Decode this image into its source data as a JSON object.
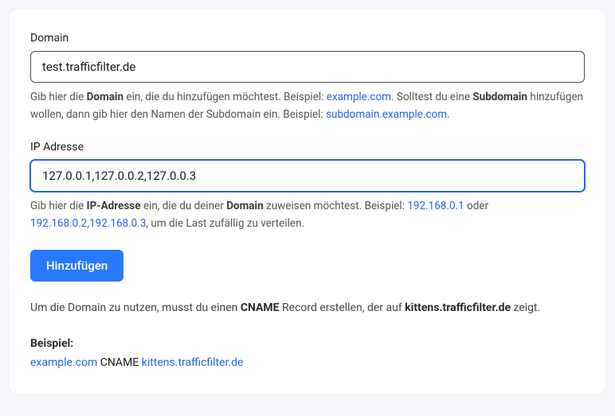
{
  "domain": {
    "label": "Domain",
    "value": "test.trafficfilter.de",
    "help_prefix": "Gib hier die ",
    "help_strong1": "Domain",
    "help_mid1": " ein, die du hinzufügen möchtest. Beispiel: ",
    "help_example1": "example.com",
    "help_mid2": ". Solltest du eine ",
    "help_strong2": "Subdomain",
    "help_mid3": " hinzufügen wollen, dann gib hier den Namen der Subdomain ein. Beispiel: ",
    "help_example2": "subdomain.example.com",
    "help_suffix": "."
  },
  "ip": {
    "label": "IP Adresse",
    "value": "127.0.0.1,127.0.0.2,127.0.0.3",
    "help_prefix": "Gib hier die ",
    "help_strong1": "IP-Adresse",
    "help_mid1": " ein, die du deiner ",
    "help_strong2": "Domain",
    "help_mid2": " zuweisen möchtest. Beispiel: ",
    "help_example1": "192.168.0.1",
    "help_mid3": " oder ",
    "help_example2": "192.168.0.2,192.168.0.3",
    "help_suffix": ", um die Last zufällig zu verteilen."
  },
  "submit": {
    "label": "Hinzufügen"
  },
  "cname": {
    "text_prefix": "Um die Domain zu nutzen, musst du einen ",
    "text_strong": "CNAME",
    "text_mid": " Record erstellen, der auf ",
    "text_target": "kittens.trafficfilter.de",
    "text_suffix": " zeigt."
  },
  "example": {
    "label": "Beispiel:",
    "domain": "example.com",
    "record_type": " CNAME ",
    "target": "kittens.trafficfilter.de"
  }
}
